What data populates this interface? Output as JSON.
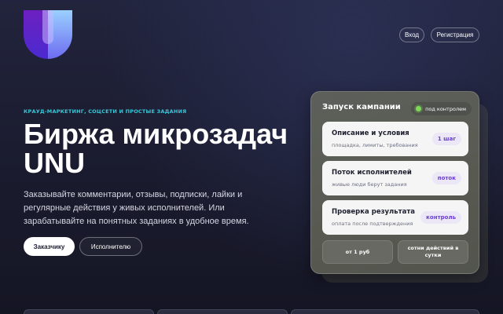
{
  "header": {
    "logo_icon": "unu-logo-icon",
    "login_label": "Вход",
    "register_label": "Регистрация"
  },
  "hero": {
    "eyebrow": "КРАУД-МАРКЕТИНГ, СОЦСЕТИ И ПРОСТЫЕ ЗАДАНИЯ",
    "title_line1": "Биржа микрозадач",
    "title_line2": "UNU",
    "description": "Заказывайте комментарии, отзывы, подписки, лайки и регулярные действия у живых исполнителей. Или зарабатывайте на понятных заданиях в удобное время.",
    "customer_button": "Заказчику",
    "performer_button": "Исполнителю"
  },
  "card": {
    "title": "Запуск кампании",
    "status": "под контролем",
    "steps": [
      {
        "title": "Описание и условия",
        "subtitle": "площадка, лимиты, требования",
        "badge": "1 шаг"
      },
      {
        "title": "Поток исполнителей",
        "subtitle": "живые люди берут задания",
        "badge": "поток"
      },
      {
        "title": "Проверка результата",
        "subtitle": "оплата после подтверждения",
        "badge": "контроль"
      }
    ],
    "stats": [
      {
        "label": "от 1 руб"
      },
      {
        "label": "сотни действий в сутки"
      }
    ]
  },
  "colors": {
    "accent_cyan": "#35c8d8",
    "badge_purple": "#6a3fd0",
    "status_green": "#7ed957",
    "background": "#1e1f33"
  }
}
